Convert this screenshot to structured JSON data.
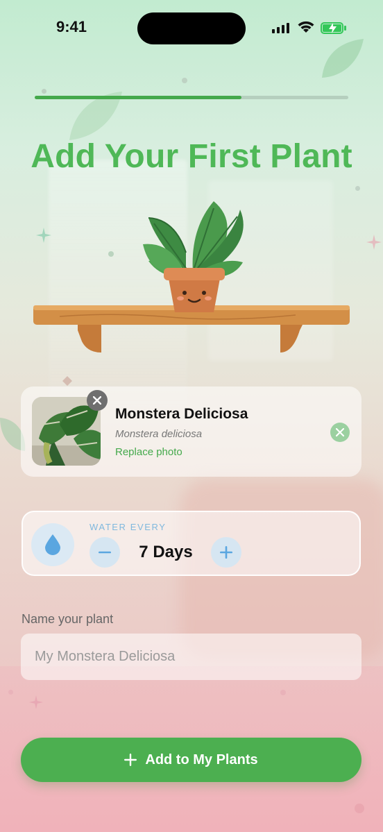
{
  "status_bar": {
    "time": "9:41"
  },
  "progress": {
    "fraction": 0.66
  },
  "header": {
    "title": "Add Your First Plant"
  },
  "plant_card": {
    "name": "Monstera Deliciosa",
    "scientific_name": "Monstera deliciosa",
    "replace_photo_label": "Replace photo"
  },
  "water": {
    "label": "WATER EVERY",
    "value": "7 Days"
  },
  "name_field": {
    "label": "Name your plant",
    "placeholder": "My Monstera Deliciosa"
  },
  "add_button": {
    "label": "Add to My Plants"
  },
  "colors": {
    "accent": "#4caf50",
    "title": "#4fb857",
    "water_blue": "#5aa6e0"
  }
}
